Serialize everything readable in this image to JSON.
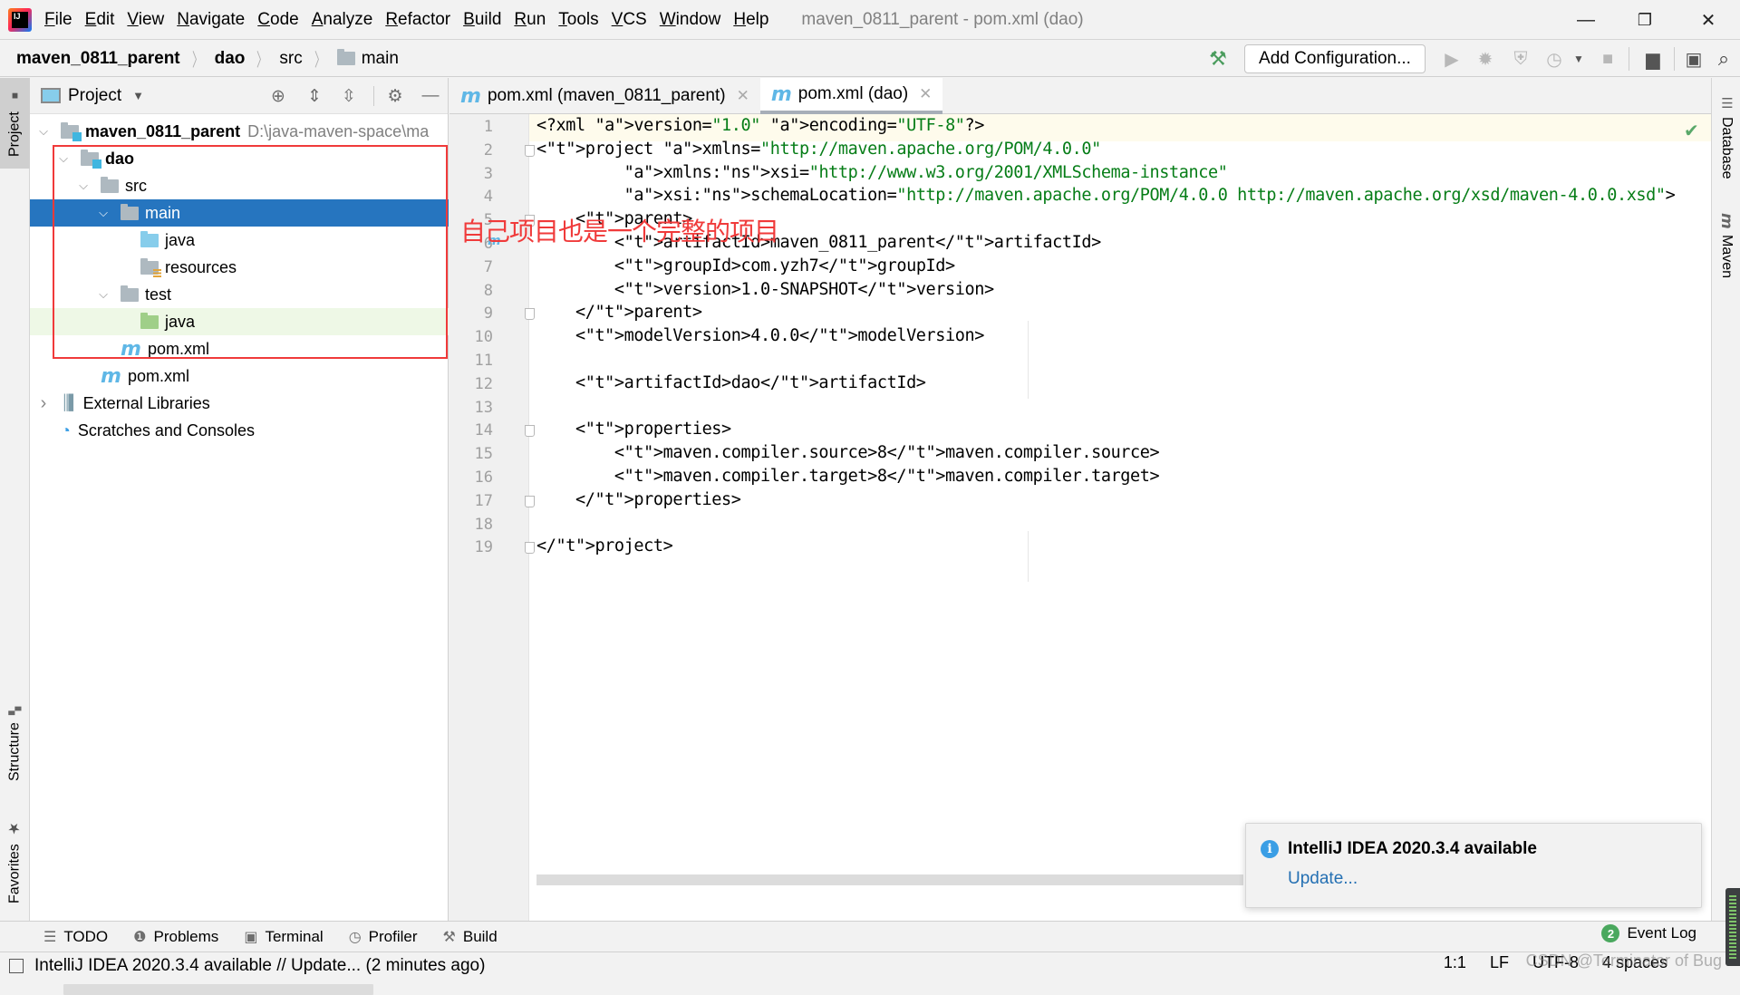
{
  "menubar": {
    "items": [
      "File",
      "Edit",
      "View",
      "Navigate",
      "Code",
      "Analyze",
      "Refactor",
      "Build",
      "Run",
      "Tools",
      "VCS",
      "Window",
      "Help"
    ],
    "window_title": "maven_0811_parent - pom.xml (dao)"
  },
  "window_controls": {
    "minimize": "—",
    "restore": "❐",
    "close": "✕"
  },
  "breadcrumb": [
    {
      "label": "maven_0811_parent",
      "bold": true
    },
    {
      "label": "dao",
      "bold": true
    },
    {
      "label": "src",
      "bold": false
    },
    {
      "label": "main",
      "bold": false,
      "folder": true
    }
  ],
  "toolbar": {
    "add_configuration": "Add Configuration...",
    "icons": [
      "build-hammer-icon",
      "run-icon",
      "debug-icon",
      "coverage-icon",
      "profile-icon",
      "dropdown-icon",
      "stop-icon",
      "project-structure-icon",
      "run-anything-icon",
      "search-icon"
    ]
  },
  "left_stripe": {
    "top_tab": "Project",
    "bottom_tabs": [
      "Structure",
      "Favorites"
    ]
  },
  "right_stripe": {
    "tabs": [
      "Database",
      "Maven"
    ]
  },
  "project_panel": {
    "title": "Project",
    "tree": [
      {
        "label": "maven_0811_parent",
        "path": "D:\\java-maven-space\\ma",
        "bold": true,
        "level": 0,
        "expanded": true,
        "icon": "module-folder"
      },
      {
        "label": "dao",
        "bold": true,
        "level": 1,
        "expanded": true,
        "icon": "module-folder"
      },
      {
        "label": "src",
        "level": 2,
        "expanded": true,
        "icon": "folder"
      },
      {
        "label": "main",
        "level": 3,
        "expanded": true,
        "icon": "folder",
        "selected": true
      },
      {
        "label": "java",
        "level": 4,
        "icon": "source-folder"
      },
      {
        "label": "resources",
        "level": 4,
        "icon": "resources-folder"
      },
      {
        "label": "test",
        "level": 3,
        "expanded": true,
        "icon": "folder"
      },
      {
        "label": "java",
        "level": 4,
        "icon": "test-folder",
        "highlighted": true
      },
      {
        "label": "pom.xml",
        "level": 3,
        "icon": "maven"
      },
      {
        "label": "pom.xml",
        "level": 2,
        "icon": "maven"
      },
      {
        "label": "External Libraries",
        "level": 0,
        "expanded": false,
        "icon": "libraries"
      },
      {
        "label": "Scratches and Consoles",
        "level": 0,
        "icon": "scratches"
      }
    ]
  },
  "annotation": "自己项目也是一个完整的项目",
  "editor": {
    "tabs": [
      {
        "label": "pom.xml (maven_0811_parent)",
        "active": false
      },
      {
        "label": "pom.xml (dao)",
        "active": true
      }
    ],
    "lines": [
      "<?xml version=\"1.0\" encoding=\"UTF-8\"?>",
      "<project xmlns=\"http://maven.apache.org/POM/4.0.0\"",
      "         xmlns:xsi=\"http://www.w3.org/2001/XMLSchema-instance\"",
      "         xsi:schemaLocation=\"http://maven.apache.org/POM/4.0.0 http://maven.apache.org/xsd/maven-4.0.0.xsd\">",
      "    <parent>",
      "        <artifactId>maven_0811_parent</artifactId>",
      "        <groupId>com.yzh7</groupId>",
      "        <version>1.0-SNAPSHOT</version>",
      "    </parent>",
      "    <modelVersion>4.0.0</modelVersion>",
      "",
      "    <artifactId>dao</artifactId>",
      "",
      "    <properties>",
      "        <maven.compiler.source>8</maven.compiler.source>",
      "        <maven.compiler.target>8</maven.compiler.target>",
      "    </properties>",
      "",
      "</project>"
    ]
  },
  "notification": {
    "title": "IntelliJ IDEA 2020.3.4 available",
    "link": "Update..."
  },
  "bottom_tools": [
    "TODO",
    "Problems",
    "Terminal",
    "Profiler",
    "Build"
  ],
  "event_log": {
    "label": "Event Log",
    "count": "2"
  },
  "status": {
    "message": "IntelliJ IDEA 2020.3.4 available // Update... (2 minutes ago)",
    "position": "1:1",
    "line_sep": "LF",
    "encoding": "UTF-8",
    "indent": "4 spaces"
  },
  "watermark": "CSDN @Terminator of Bug",
  "colors": {
    "selection": "#2675bf",
    "annotation": "#f03a3a",
    "tag": "#1a1aa6",
    "attr": "#1750eb",
    "string": "#067d17"
  }
}
